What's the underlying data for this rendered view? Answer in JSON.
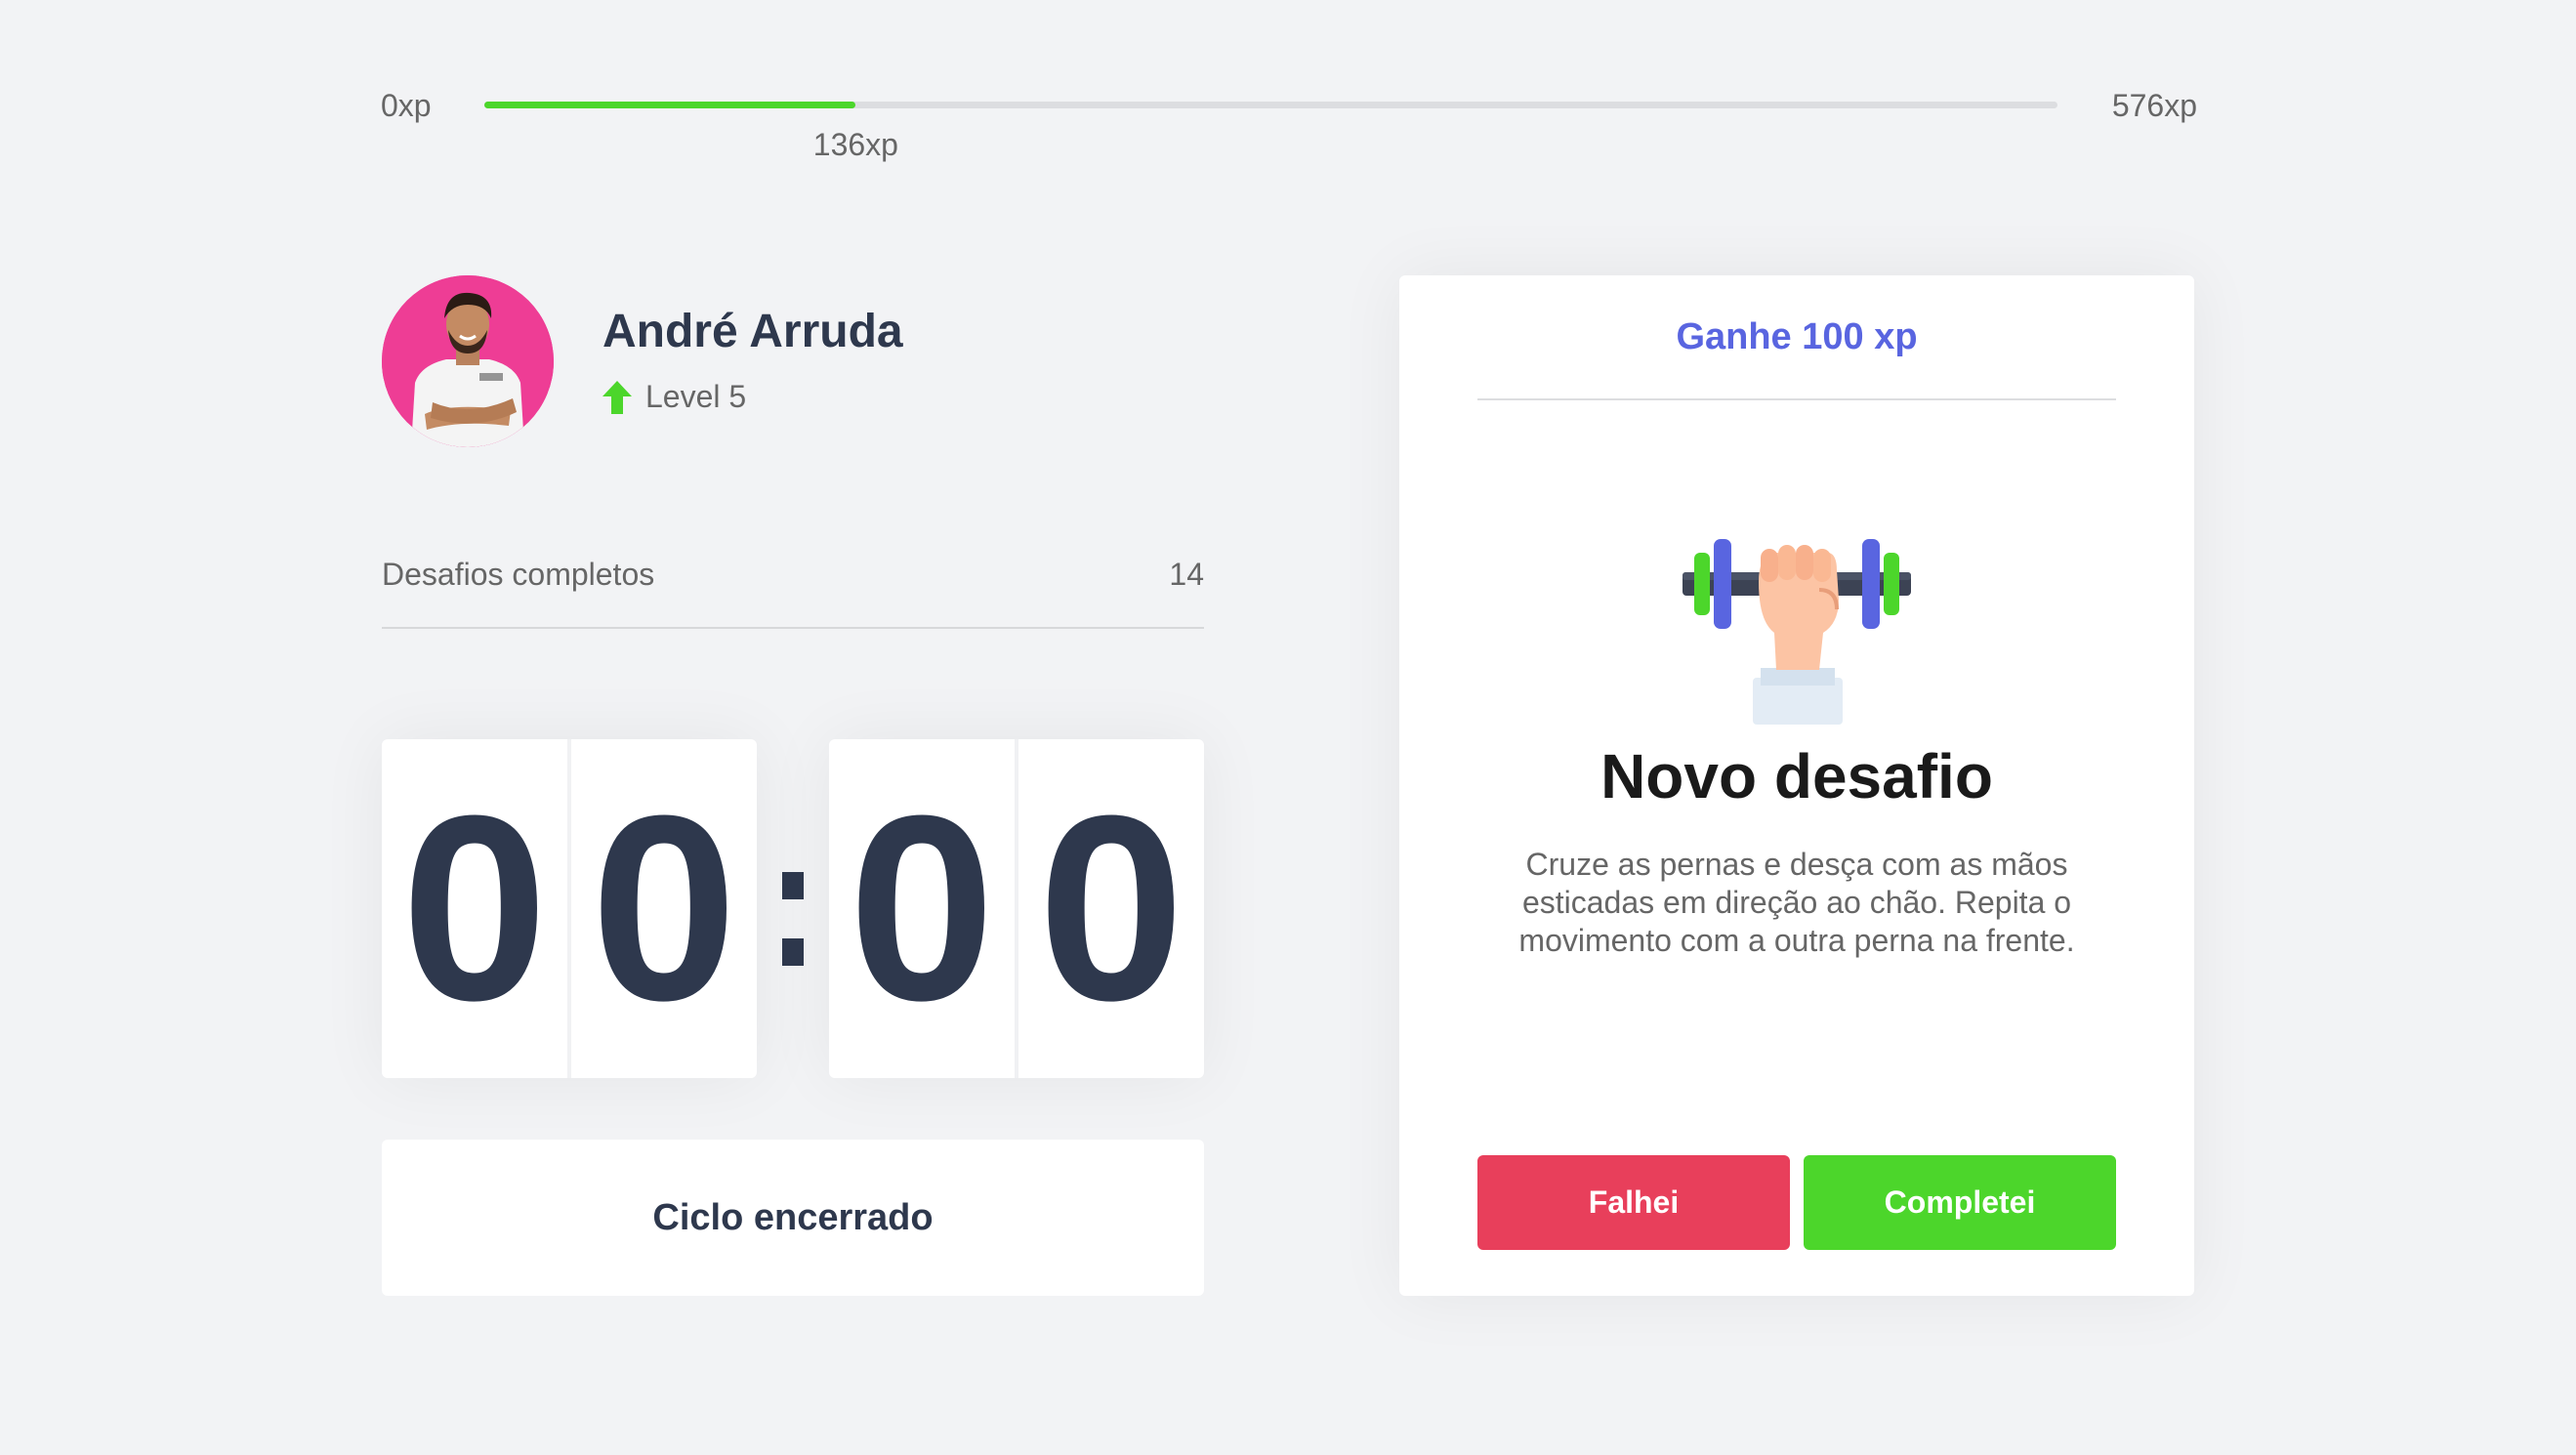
{
  "xp": {
    "min_label": "0xp",
    "current_label": "136xp",
    "max_label": "576xp",
    "current": 136,
    "max": 576
  },
  "profile": {
    "name": "André Arruda",
    "level_label": "Level 5",
    "avatar_color": "#ee3d95"
  },
  "completed": {
    "label": "Desafios completos",
    "value": "14"
  },
  "countdown": {
    "min_tens": "0",
    "min_ones": "0",
    "sec_tens": "0",
    "sec_ones": "0"
  },
  "cycle_button": {
    "label": "Ciclo encerrado"
  },
  "challenge": {
    "reward": "Ganhe 100 xp",
    "icon": "dumbbell-icon",
    "title": "Novo desafio",
    "description": "Cruze as pernas e desça com as mãos esticadas em direção ao chão. Repita o movimento com a outra perna na frente.",
    "fail_label": "Falhei",
    "success_label": "Completei"
  },
  "colors": {
    "background": "#f2f3f5",
    "accent_blue": "#5965e0",
    "green": "#4cd62b",
    "red": "#e83f5b",
    "title": "#2e384d"
  }
}
